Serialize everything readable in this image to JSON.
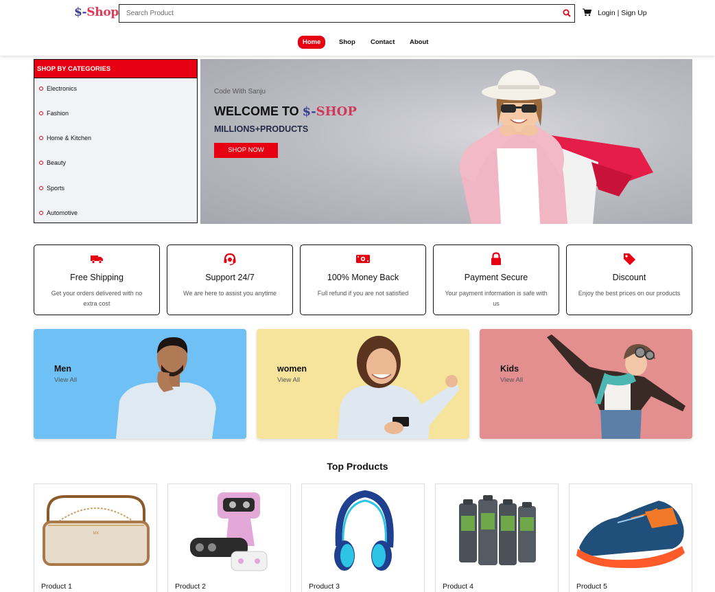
{
  "header": {
    "logo_prefix": "$-",
    "logo_suffix": "Shop",
    "search_placeholder": "Search Product",
    "login_label": "Login | Sign Up"
  },
  "nav": {
    "items": [
      "Home",
      "Shop",
      "Contact",
      "About"
    ],
    "active": "Home"
  },
  "sidebar": {
    "heading": "SHOP BY CATEGORIES",
    "items": [
      "Electronics",
      "Fashion",
      "Home & Kitchen",
      "Beauty",
      "Sports",
      "Automotive"
    ]
  },
  "hero": {
    "tagline": "Code With Sanju",
    "title_prefix": "WELCOME TO ",
    "title_brand_a": "$-",
    "title_brand_b": "SHOP",
    "subtitle": "MILLIONS+PRODUCTS",
    "button": "SHOP NOW"
  },
  "features": [
    {
      "icon": "truck-icon",
      "title": "Free Shipping",
      "desc": "Get your orders delivered with no extra cost"
    },
    {
      "icon": "headset-icon",
      "title": "Support 24/7",
      "desc": "We are here to assist you anytime"
    },
    {
      "icon": "money-icon",
      "title": "100% Money Back",
      "desc": "Full refund if you are not satisfied"
    },
    {
      "icon": "lock-icon",
      "title": "Payment Secure",
      "desc": "Your payment information is safe with us"
    },
    {
      "icon": "tag-icon",
      "title": "Discount",
      "desc": "Enjoy the best prices on our products"
    }
  ],
  "categories": [
    {
      "name": "Men",
      "link": "View All",
      "bg": "#6ec0f5"
    },
    {
      "name": "women",
      "link": "View All",
      "bg": "#f7e49c"
    },
    {
      "name": "Kids",
      "link": "View All",
      "bg": "#e48f8f"
    }
  ],
  "top_products": {
    "title": "Top Products",
    "items": [
      "Product 1",
      "Product 2",
      "Product 3",
      "Product 4",
      "Product 5"
    ]
  },
  "colors": {
    "accent": "#e60012",
    "logo_blue": "#3a3f8f",
    "logo_pink": "#e23b58"
  }
}
